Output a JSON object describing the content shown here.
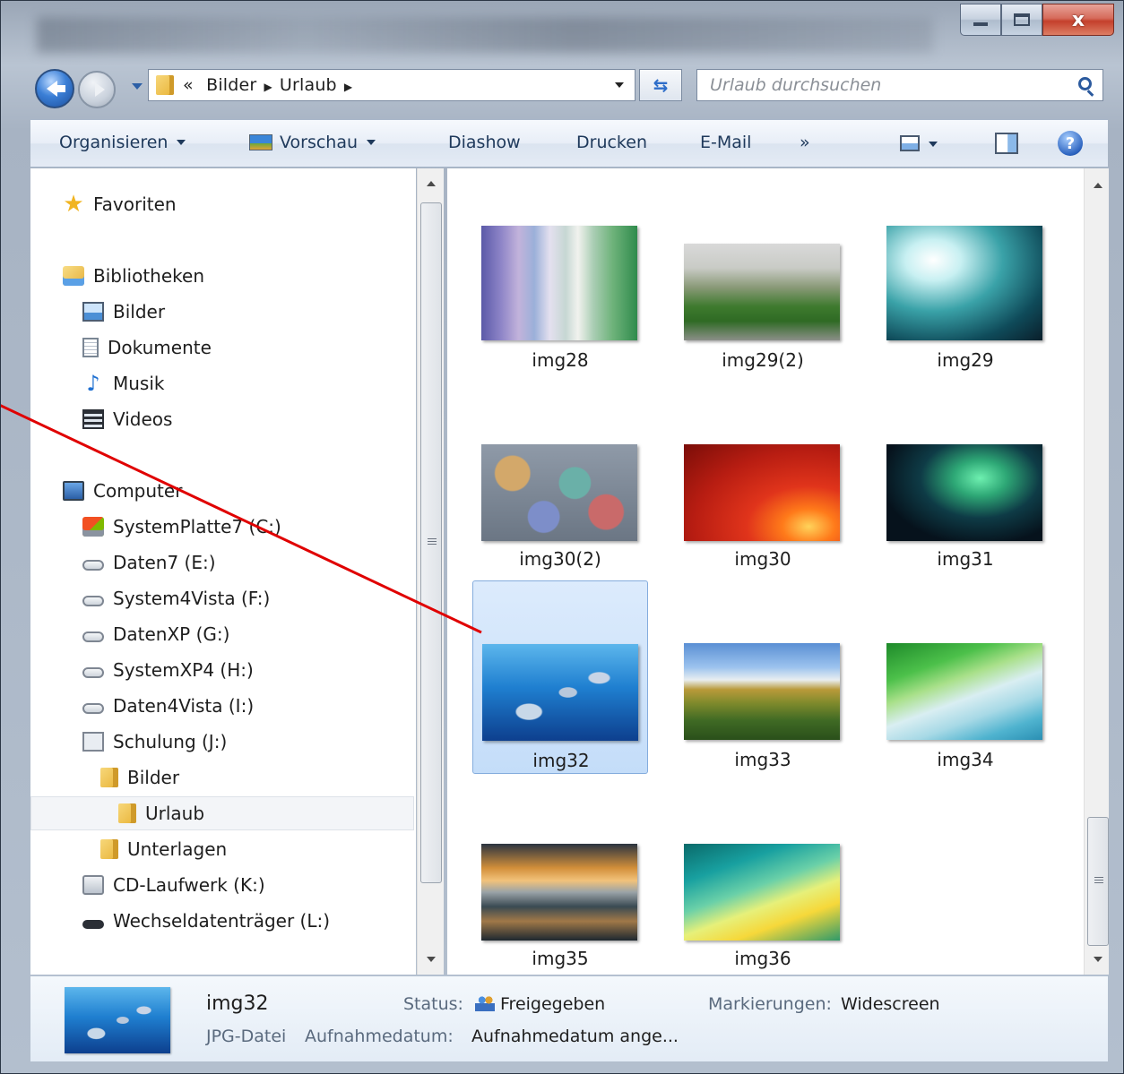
{
  "window": {
    "controls": {
      "close_label": "x"
    }
  },
  "navigation": {
    "address_prefix": "«",
    "breadcrumb": [
      "Bilder",
      "Urlaub"
    ],
    "search_placeholder": "Urlaub durchsuchen"
  },
  "toolbar": {
    "organize": "Organisieren",
    "preview": "Vorschau",
    "slideshow": "Diashow",
    "print": "Drucken",
    "email": "E-Mail",
    "more": "»",
    "help": "?"
  },
  "sidebar": {
    "favorites": "Favoriten",
    "libraries": "Bibliotheken",
    "library_items": [
      "Bilder",
      "Dokumente",
      "Musik",
      "Videos"
    ],
    "computer": "Computer",
    "drives": [
      "SystemPlatte7 (C:)",
      "Daten7 (E:)",
      "System4Vista (F:)",
      "DatenXP (G:)",
      "SystemXP4 (H:)",
      "Daten4Vista (I:)",
      "Schulung (J:)"
    ],
    "schulung_children": [
      "Bilder",
      "Urlaub",
      "Unterlagen"
    ],
    "selected": "Urlaub",
    "other_drives": [
      "CD-Laufwerk (K:)",
      "Wechseldatenträger (L:)"
    ]
  },
  "files": [
    {
      "name": "img28",
      "thumb": "th-28"
    },
    {
      "name": "img29(2)",
      "thumb": "th-29-2"
    },
    {
      "name": "img29",
      "thumb": "th-29"
    },
    {
      "name": "img30(2)",
      "thumb": "th-30-2"
    },
    {
      "name": "img30",
      "thumb": "th-30"
    },
    {
      "name": "img31",
      "thumb": "th-31"
    },
    {
      "name": "img32",
      "thumb": "th-32",
      "selected": true
    },
    {
      "name": "img33",
      "thumb": "th-33"
    },
    {
      "name": "img34",
      "thumb": "th-34"
    },
    {
      "name": "img35",
      "thumb": "th-35"
    },
    {
      "name": "img36",
      "thumb": "th-36"
    }
  ],
  "details": {
    "name": "img32",
    "type": "JPG-Datei",
    "status_label": "Status:",
    "status_value": "Freigegeben",
    "tags_label": "Markierungen:",
    "tags_value": "Widescreen",
    "date_label": "Aufnahmedatum:",
    "date_value": "Aufnahmedatum ange..."
  },
  "annotation": {
    "color": "#e00000",
    "target": "img32"
  }
}
